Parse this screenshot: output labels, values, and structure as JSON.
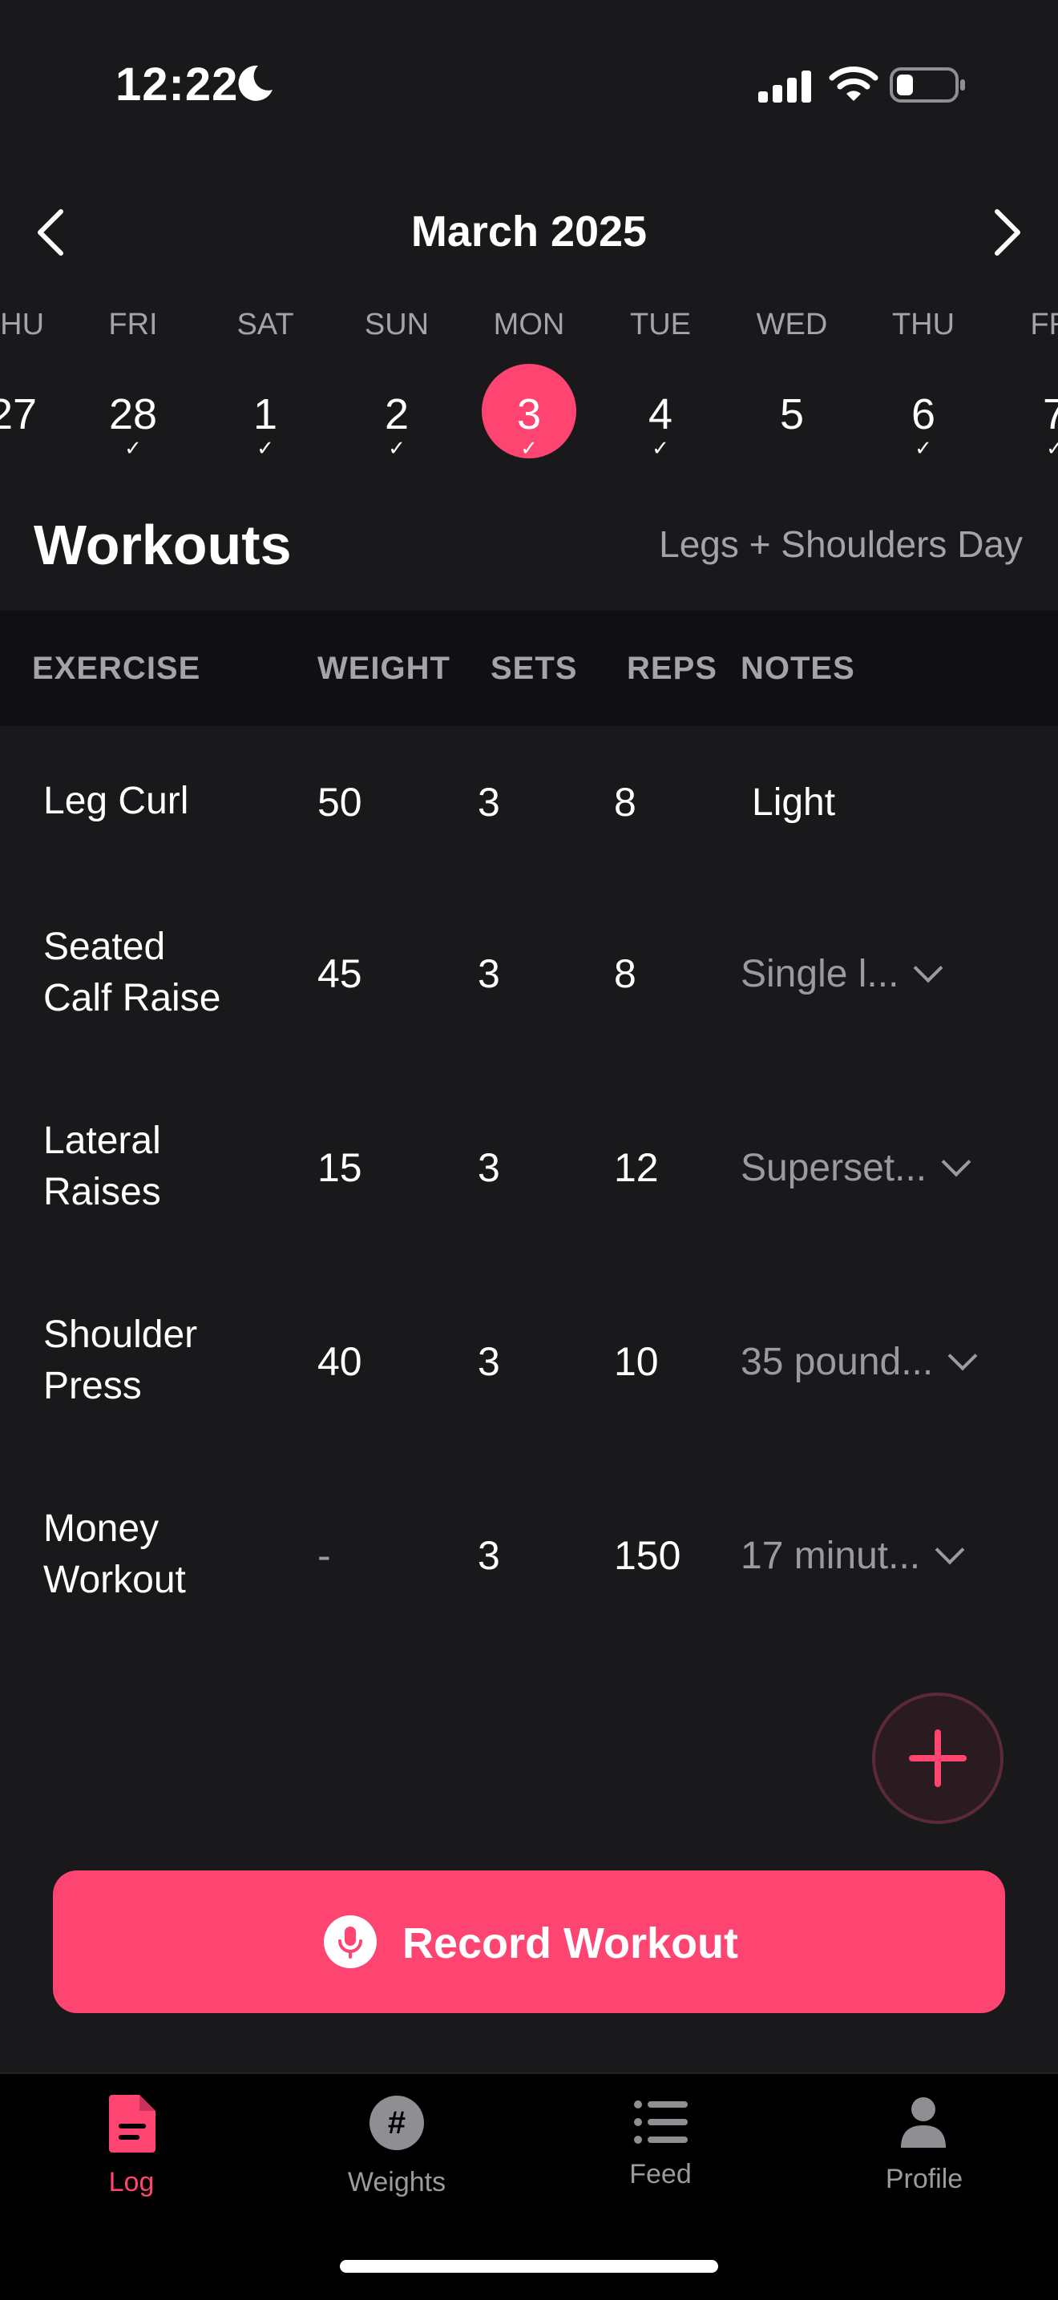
{
  "status_bar": {
    "time": "12:22",
    "icons": [
      "moon-icon",
      "signal-icon",
      "wifi-icon",
      "battery-icon"
    ]
  },
  "calendar": {
    "month_title": "March 2025",
    "days": [
      {
        "dow": "THU",
        "num": "27",
        "checked": false,
        "selected": false
      },
      {
        "dow": "FRI",
        "num": "28",
        "checked": true,
        "selected": false
      },
      {
        "dow": "SAT",
        "num": "1",
        "checked": true,
        "selected": false
      },
      {
        "dow": "SUN",
        "num": "2",
        "checked": true,
        "selected": false
      },
      {
        "dow": "MON",
        "num": "3",
        "checked": true,
        "selected": true
      },
      {
        "dow": "TUE",
        "num": "4",
        "checked": true,
        "selected": false
      },
      {
        "dow": "WED",
        "num": "5",
        "checked": false,
        "selected": false
      },
      {
        "dow": "THU",
        "num": "6",
        "checked": true,
        "selected": false
      },
      {
        "dow": "FRI",
        "num": "7",
        "checked": true,
        "selected": false
      }
    ]
  },
  "workouts": {
    "title": "Workouts",
    "day_label": "Legs + Shoulders Day",
    "columns": [
      "EXERCISE",
      "WEIGHT",
      "SETS",
      "REPS",
      "NOTES"
    ],
    "rows": [
      {
        "exercise_line1": "Leg Curl",
        "exercise_line2": "",
        "weight": "50",
        "sets": "3",
        "reps": "8",
        "notes": "Light",
        "notes_expandable": false
      },
      {
        "exercise_line1": "Seated",
        "exercise_line2": "Calf Raise",
        "weight": "45",
        "sets": "3",
        "reps": "8",
        "notes": "Single l...",
        "notes_expandable": true
      },
      {
        "exercise_line1": "Lateral",
        "exercise_line2": "Raises",
        "weight": "15",
        "sets": "3",
        "reps": "12",
        "notes": "Superset...",
        "notes_expandable": true
      },
      {
        "exercise_line1": "Shoulder",
        "exercise_line2": "Press",
        "weight": "40",
        "sets": "3",
        "reps": "10",
        "notes": "35 pound...",
        "notes_expandable": true
      },
      {
        "exercise_line1": "Money",
        "exercise_line2": "Workout",
        "weight": "-",
        "sets": "3",
        "reps": "150",
        "notes": "17 minut...",
        "notes_expandable": true
      }
    ]
  },
  "actions": {
    "record_label": "Record Workout",
    "fab_icon": "plus-icon"
  },
  "tabs": [
    {
      "label": "Log",
      "icon": "document-icon",
      "active": true
    },
    {
      "label": "Weights",
      "icon": "hashtag-icon",
      "active": false
    },
    {
      "label": "Feed",
      "icon": "list-icon",
      "active": false
    },
    {
      "label": "Profile",
      "icon": "person-icon",
      "active": false
    }
  ],
  "colors": {
    "accent": "#fe4470",
    "background": "#19191b",
    "header_background": "#101012",
    "muted_text": "#a3a3a8"
  }
}
